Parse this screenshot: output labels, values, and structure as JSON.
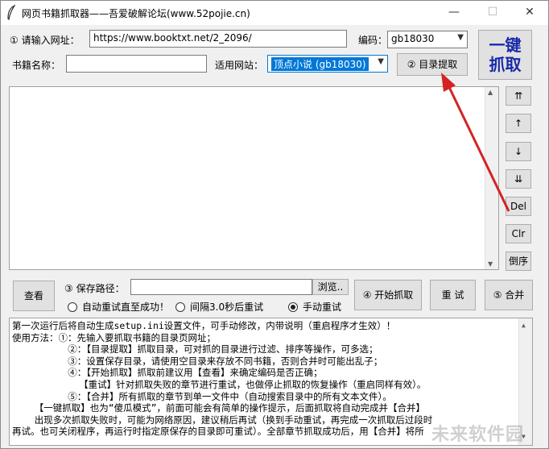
{
  "window": {
    "title": "网页书籍抓取器——吾爱破解论坛(www.52pojie.cn)",
    "controls": {
      "minimize": "—",
      "maximize": "☐",
      "close": "✕"
    }
  },
  "form": {
    "url_label": "① 请输入网址：",
    "url_value": "https://www.booktxt.net/2_2096/",
    "encoding_label": "编码：",
    "encoding_value": "gb18030",
    "book_name_label": "书籍名称：",
    "book_name_value": "",
    "site_label": "适用网站：",
    "site_value": "顶点小说  (gb18030)",
    "toc_button": "② 目录提取",
    "one_click_line1": "一键",
    "one_click_line2": "抓取"
  },
  "side_buttons": [
    "⇈",
    "↑",
    "↓",
    "⇊",
    "Del",
    "Clr",
    "倒序"
  ],
  "bottom": {
    "view_button": "查看",
    "save_path_label": "③ 保存路径：",
    "save_path_value": "",
    "browse_button": "浏览..",
    "start_button": "④ 开始抓取",
    "retry_button": "重 试",
    "merge_button": "⑤ 合并",
    "radio_options": [
      {
        "label": "自动重试直至成功！",
        "selected": false
      },
      {
        "label": "间隔3.0秒后重试",
        "selected": false
      },
      {
        "label": "手动重试",
        "selected": true
      }
    ]
  },
  "help_text": [
    "第一次运行后将自动生成setup.ini设置文件，可手动修改，内带说明（重启程序才生效）！",
    "使用方法：①：先输入要抓取书籍的目录页网址；",
    "          ②：【目录提取】抓取目录，可对抓的目录进行过滤、排序等操作，可多选；",
    "          ③：设置保存目录，请使用空目录来存放不同书籍，否则合并时可能出乱子；",
    "          ④：【开始抓取】抓取前建议用【查看】来确定编码是否正确；",
    "            【重试】针对抓取失败的章节进行重试，也做停止抓取的恢复操作（重启同样有效）。",
    "          ⑤：【合并】所有抓取的章节到单一文件中（自动搜索目录中的所有文本文件）。",
    "    【一键抓取】也为“傻瓜模式”，前面可能会有简单的操作提示，后面抓取将自动完成并【合并】",
    "    出现多次抓取失败时，可能为网络原因，建议稍后再试（换到手动重试，再完成一次抓取后过段时",
    "再试。也可关闭程序，再运行时指定原保存的目录即可重试）。全部章节抓取成功后，用【合并】将所"
  ],
  "watermark": "未来软件园",
  "colors": {
    "accent": "#0078d7",
    "one_click_text": "#1a2aa8",
    "annotation_arrow": "#d42323"
  }
}
